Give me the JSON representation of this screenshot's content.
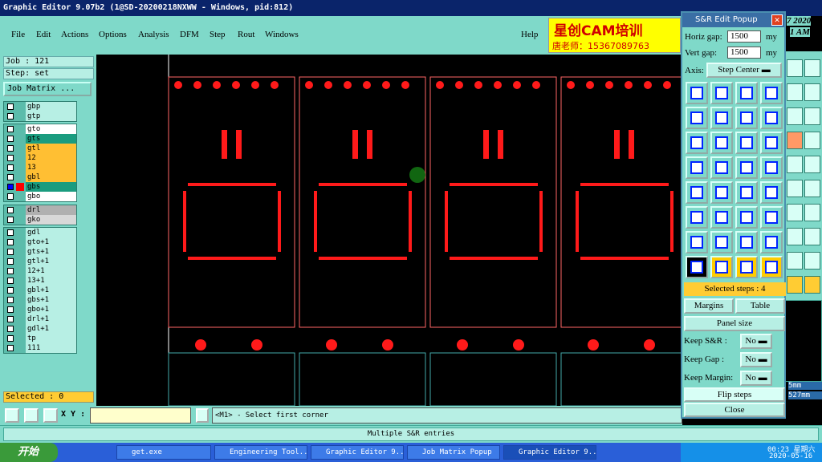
{
  "window": {
    "title": "Graphic Editor 9.07b2 (1@SD-20200218NXWW - Windows, pid:812)"
  },
  "menu": [
    "File",
    "Edit",
    "Actions",
    "Options",
    "Analysis",
    "DFM",
    "Step",
    "Rout",
    "Windows",
    "Help"
  ],
  "ad": {
    "line1": "星创CAM培训",
    "line2": "唐老师：15367089763"
  },
  "left_panel": {
    "job": "Job : 121",
    "step": "Step: set",
    "job_matrix_button": "Job Matrix ...",
    "layers_group1": [
      "gbp",
      "gtp"
    ],
    "layers_group2": [
      "gto",
      "gts",
      "gtl",
      "12",
      "13",
      "gbl",
      "gbs",
      "gbo"
    ],
    "layers_group3": [
      "drl",
      "gko"
    ],
    "layers_group4": [
      "gdl",
      "gto+1",
      "gts+1",
      "gtl+1",
      "12+1",
      "13+1",
      "gbl+1",
      "gbs+1",
      "gbo+1",
      "drl+1",
      "gdl+1",
      "tp",
      "111"
    ],
    "selected": "Selected : 0"
  },
  "bottom_bar": {
    "xy_label": "X Y :",
    "message": "<M1> - Select first corner"
  },
  "status": "Multiple S&R entries",
  "clock_partial": {
    "year": "7 2020",
    "time": "1 AM",
    "mm1": "5mm",
    "mm2": "527mm"
  },
  "popup": {
    "title": "S&R Edit Popup",
    "horiz_label": "Horiz gap:",
    "horiz_value": "1500",
    "vert_label": "Vert  gap:",
    "vert_value": "1500",
    "unit": "my",
    "axis_label": "Axis:",
    "axis_value": "Step Center",
    "selected_steps": "Selected steps : 4",
    "margins": "Margins",
    "table": "Table",
    "panel_size": "Panel size",
    "keep_sr_label": "Keep S&R :",
    "keep_sr_value": "No",
    "keep_gap_label": "Keep Gap :",
    "keep_gap_value": "No",
    "keep_margin_label": "Keep Margin:",
    "keep_margin_value": "No",
    "flip_steps": "Flip steps",
    "close": "Close"
  },
  "taskbar": {
    "start": "开始",
    "buttons": [
      "get.exe",
      "Engineering Tool...",
      "Graphic Editor 9...",
      "Job Matrix Popup",
      "Graphic Editor 9..."
    ],
    "time": "00:23 星期六",
    "date": "2020-05-16"
  },
  "colors": {
    "panel": "#7fd9c9",
    "pcb": "#ff0000",
    "accent_yellow": "#ffcc33",
    "title_blue": "#0a246a"
  }
}
